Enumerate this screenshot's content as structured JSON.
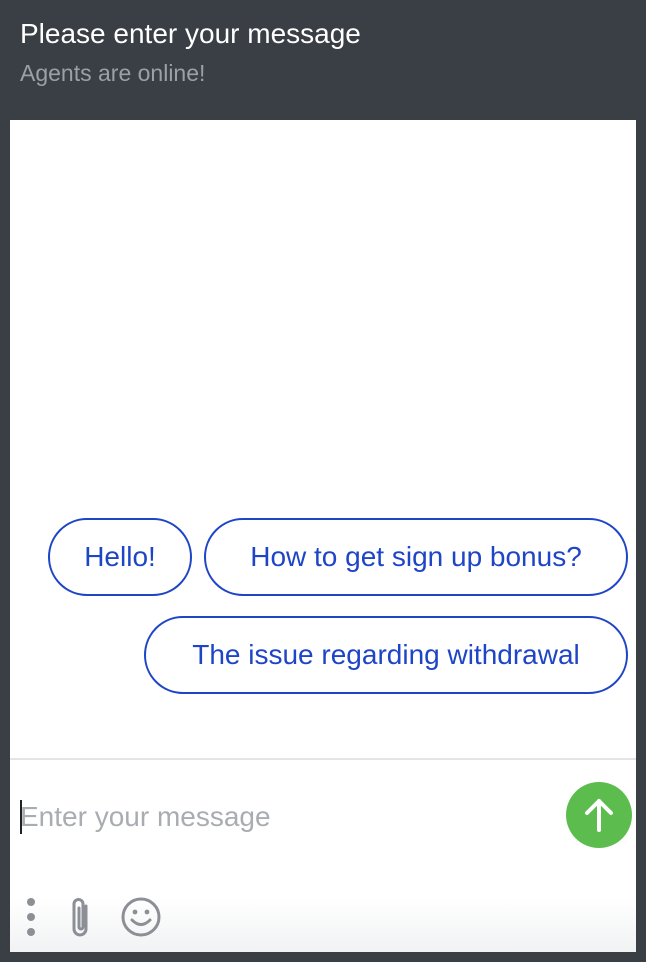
{
  "header": {
    "title": "Please enter your message",
    "status": "Agents are online!"
  },
  "quick_replies": [
    {
      "label": "Hello!"
    },
    {
      "label": "How to get sign up bonus?"
    },
    {
      "label": "The issue regarding withdrawal"
    }
  ],
  "composer": {
    "placeholder": "Enter your message",
    "value": "",
    "send_icon": "arrow-up-icon",
    "tools": [
      "more-vertical-icon",
      "paperclip-icon",
      "emoji-icon"
    ]
  },
  "colors": {
    "header_bg": "#3a3e45",
    "header_title": "#ffffff",
    "header_status": "#9aa0a7",
    "chip_accent": "#1f45c7",
    "send_button": "#5cbd4e",
    "icon_gray": "#8c9096"
  }
}
